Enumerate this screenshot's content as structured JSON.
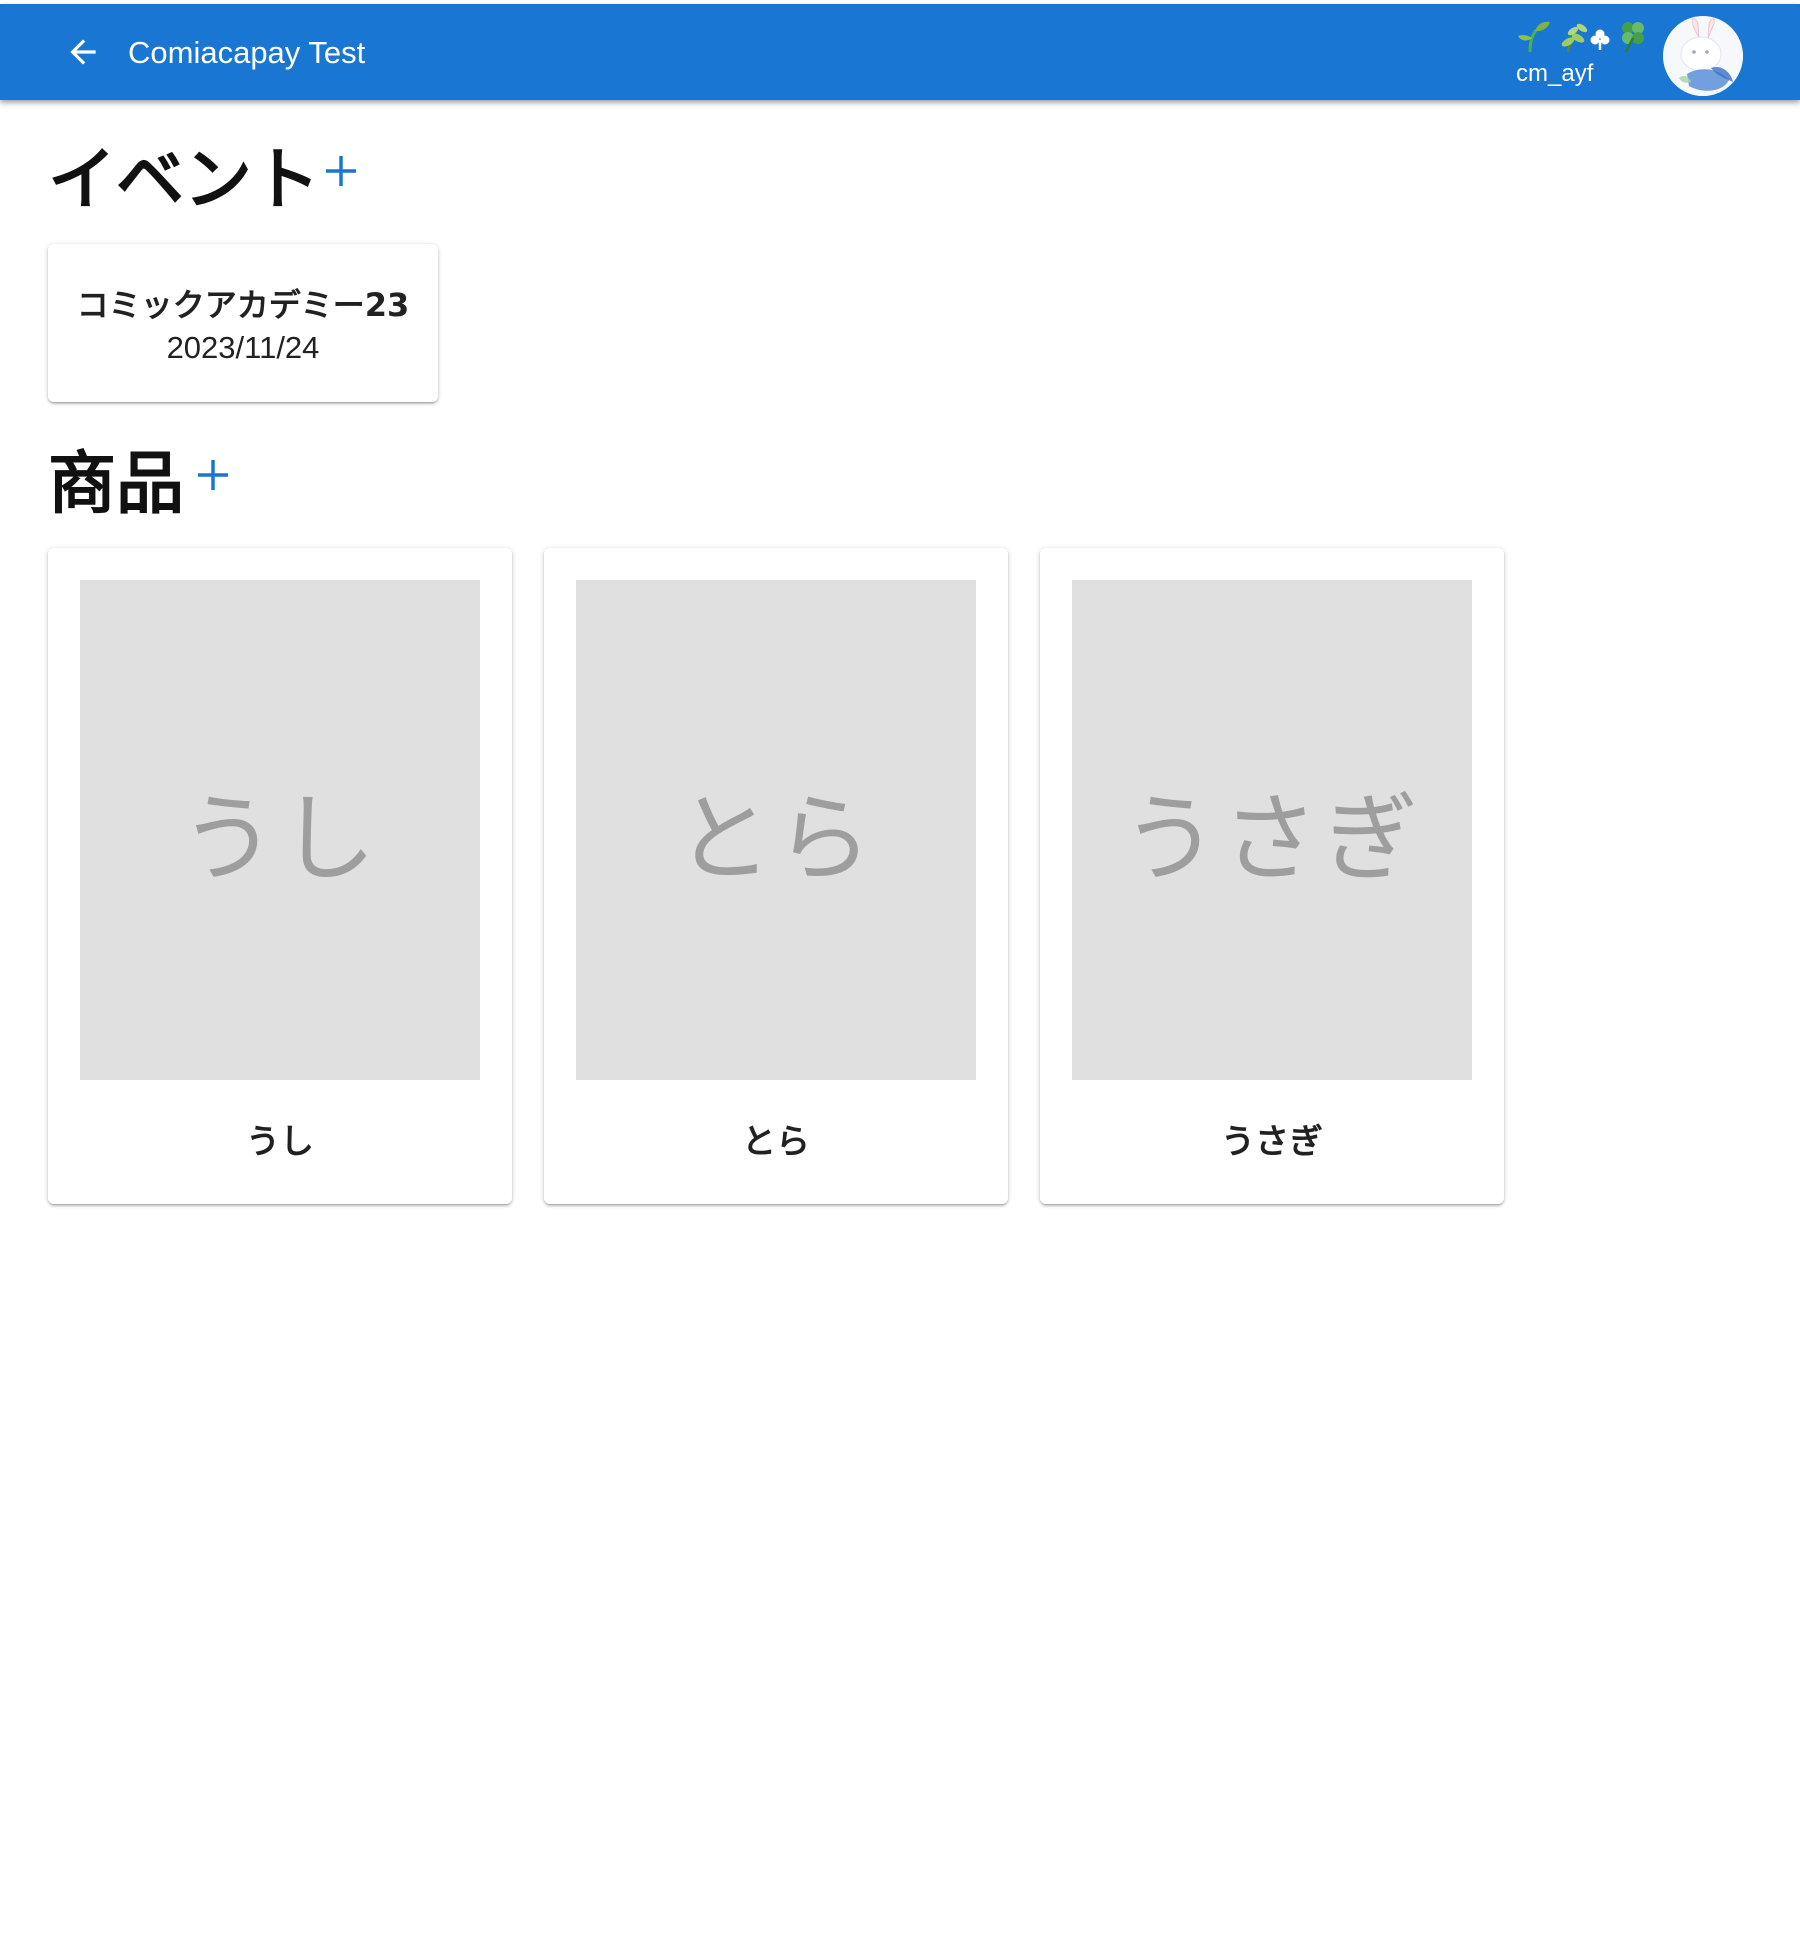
{
  "appbar": {
    "title": "Comiacapay Test",
    "back_icon": "arrow-back-icon",
    "background_color": "#1976d2",
    "user": {
      "decoration": "🌱🌿☘🍀",
      "name": "cm_ayf",
      "avatar_icon": "rabbit-avatar-icon"
    }
  },
  "events_section": {
    "heading": "イベント",
    "add_icon": "plus-icon",
    "items": [
      {
        "name": "コミックアカデミー23",
        "date": "2023/11/24"
      }
    ]
  },
  "products_section": {
    "heading": "商品",
    "add_icon": "plus-icon",
    "items": [
      {
        "image_placeholder": "うし",
        "name": "うし"
      },
      {
        "image_placeholder": "とら",
        "name": "とら"
      },
      {
        "image_placeholder": "うさぎ",
        "name": "うさぎ"
      }
    ]
  },
  "colors": {
    "accent": "#1976d2",
    "placeholder_bg": "#e0e0e0",
    "placeholder_text": "#9e9e9e"
  }
}
